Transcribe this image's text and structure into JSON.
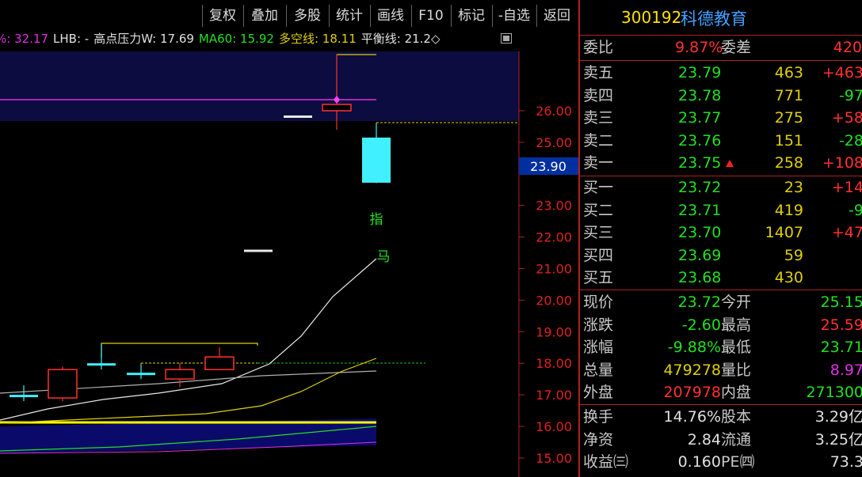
{
  "toolbar": {
    "buttons": [
      "复权",
      "叠加",
      "多股",
      "统计",
      "画线",
      "F10",
      "标记",
      "-自选",
      "返回"
    ]
  },
  "indicators": [
    {
      "label": "%: 32.17",
      "color": "#e030e0"
    },
    {
      "label": "LHB: -",
      "color": "#e0e0e0"
    },
    {
      "label": "高点压力W: 17.69",
      "color": "#e0e0e0"
    },
    {
      "label": "MA60: 15.92",
      "color": "#20e020"
    },
    {
      "label": "多空线: 18.11",
      "color": "#e0d000"
    },
    {
      "label": "平衡线: 21.2◇",
      "color": "#e0e0e0"
    }
  ],
  "price_axis": {
    "ticks": [
      "26.00",
      "25.00",
      "23.00",
      "22.00",
      "21.00",
      "20.00",
      "19.00",
      "18.00",
      "17.00",
      "16.00",
      "15.00"
    ],
    "current_price": "23.90"
  },
  "chart_annotations": {
    "zhi": "指",
    "ma": "马"
  },
  "stock": {
    "code": "300192",
    "name": "科德教育"
  },
  "weibi": {
    "label": "委比",
    "value": "9.87%",
    "label2": "委差",
    "value2": "420"
  },
  "sell": [
    {
      "label": "卖五",
      "price": "23.79",
      "vol": "463",
      "chg": "+463"
    },
    {
      "label": "卖四",
      "price": "23.78",
      "vol": "771",
      "chg": "-97"
    },
    {
      "label": "卖三",
      "price": "23.77",
      "vol": "275",
      "chg": "+58"
    },
    {
      "label": "卖二",
      "price": "23.76",
      "vol": "151",
      "chg": "-28"
    },
    {
      "label": "卖一",
      "price": "23.75",
      "vol": "258",
      "chg": "+108"
    }
  ],
  "buy": [
    {
      "label": "买一",
      "price": "23.72",
      "vol": "23",
      "chg": "+14"
    },
    {
      "label": "买二",
      "price": "23.71",
      "vol": "419",
      "chg": "-9"
    },
    {
      "label": "买三",
      "price": "23.70",
      "vol": "1407",
      "chg": "+47"
    },
    {
      "label": "买四",
      "price": "23.69",
      "vol": "59",
      "chg": ""
    },
    {
      "label": "买五",
      "price": "23.68",
      "vol": "430",
      "chg": ""
    }
  ],
  "quote": [
    {
      "l1": "现价",
      "v1": "23.72",
      "l2": "今开",
      "v2": "25.15"
    },
    {
      "l1": "涨跌",
      "v1": "-2.60",
      "l2": "最高",
      "v2": "25.59"
    },
    {
      "l1": "涨幅",
      "v1": "-9.88%",
      "l2": "最低",
      "v2": "23.71"
    },
    {
      "l1": "总量",
      "v1": "479278",
      "l2": "量比",
      "v2": "8.97"
    },
    {
      "l1": "外盘",
      "v1": "207978",
      "l2": "内盘",
      "v2": "271300"
    }
  ],
  "fund": [
    {
      "l1": "换手",
      "v1": "14.76%",
      "l2": "股本",
      "v2": "3.29亿"
    },
    {
      "l1": "净资",
      "v1": "2.84",
      "l2": "流通",
      "v2": "3.25亿"
    },
    {
      "l1": "收益㈢",
      "v1": "0.160",
      "l2": "PE㈣",
      "v2": "73.3"
    }
  ],
  "chart_data": {
    "type": "candlestick",
    "candles": [
      {
        "open": 17.0,
        "close": 17.0,
        "high": 17.3,
        "low": 16.8,
        "color": "cyan"
      },
      {
        "open": 16.9,
        "close": 17.8,
        "high": 17.9,
        "low": 16.8,
        "color": "red"
      },
      {
        "open": 18.0,
        "close": 18.0,
        "high": 18.6,
        "low": 17.8,
        "color": "cyan"
      },
      {
        "open": 17.7,
        "close": 17.7,
        "high": 17.95,
        "low": 17.5,
        "color": "cyan"
      },
      {
        "open": 17.5,
        "close": 17.8,
        "high": 18.0,
        "low": 17.25,
        "color": "red"
      },
      {
        "open": 17.8,
        "close": 18.2,
        "high": 18.5,
        "low": 17.8,
        "color": "red"
      },
      {
        "open": 21.6,
        "close": 21.6,
        "high": 21.6,
        "low": 21.6,
        "color": "white"
      },
      {
        "open": 25.85,
        "close": 25.85,
        "high": 25.85,
        "low": 25.85,
        "color": "white"
      },
      {
        "open": 26.0,
        "close": 26.2,
        "high": 27.8,
        "low": 25.4,
        "color": "red"
      },
      {
        "open": 25.15,
        "close": 23.72,
        "high": 25.59,
        "low": 23.71,
        "color": "cyan"
      }
    ]
  }
}
